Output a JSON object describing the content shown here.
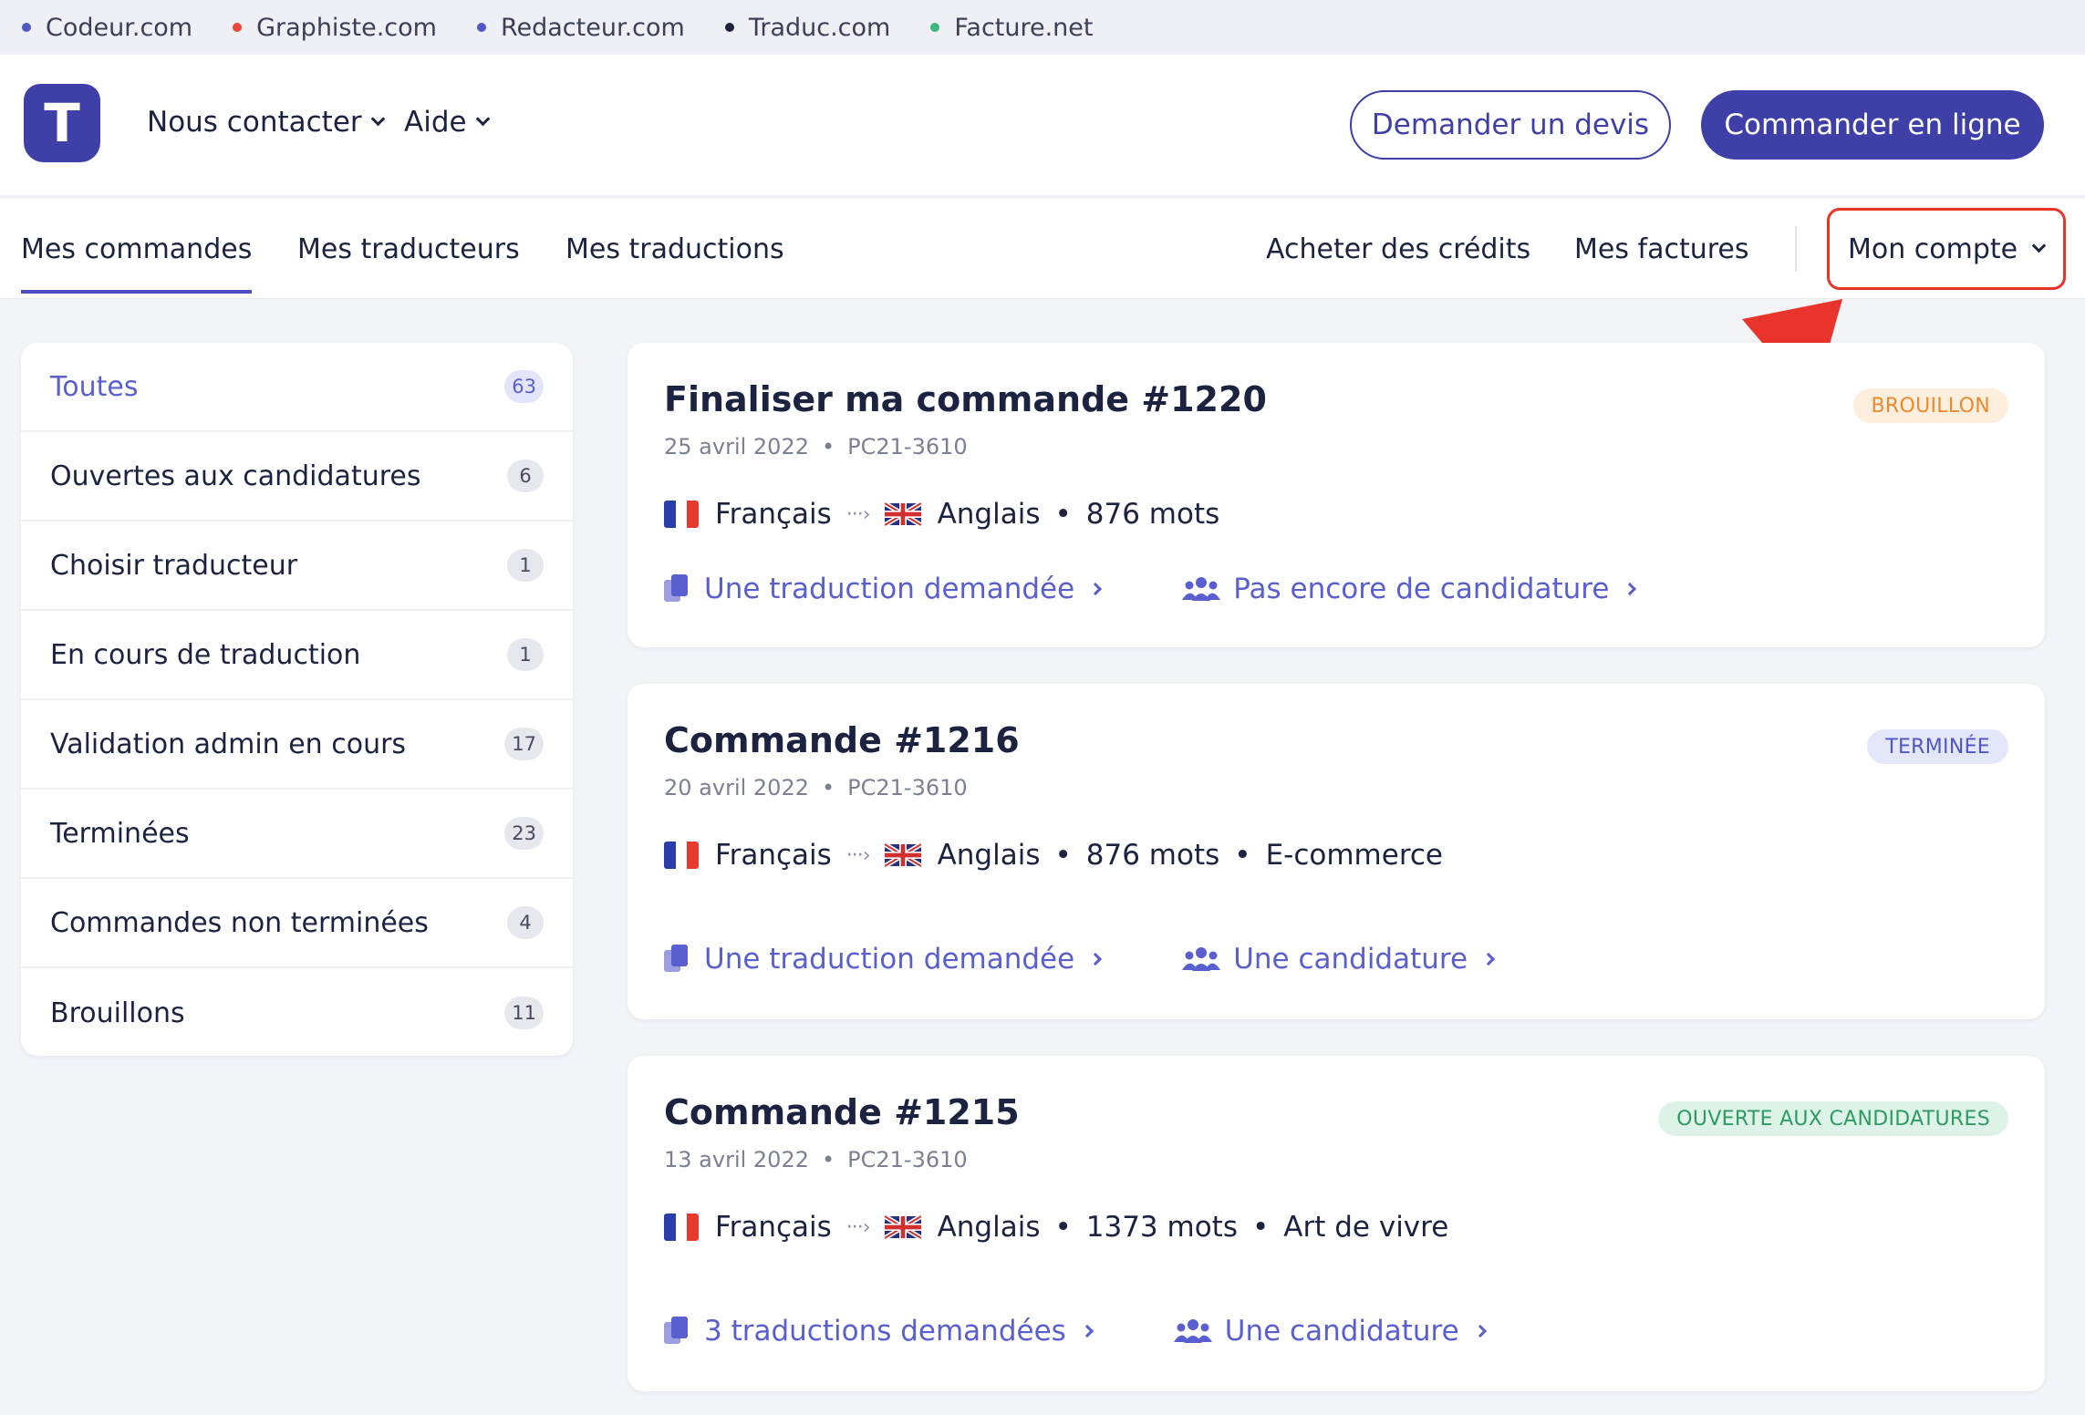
{
  "network": [
    {
      "label": "Codeur.com",
      "color": "#4f57c6"
    },
    {
      "label": "Graphiste.com",
      "color": "#e8453c"
    },
    {
      "label": "Redacteur.com",
      "color": "#4f57c6"
    },
    {
      "label": "Traduc.com",
      "color": "#1c2340"
    },
    {
      "label": "Facture.net",
      "color": "#3fb77c"
    }
  ],
  "header": {
    "logo_letter": "T",
    "contact_label": "Nous contacter",
    "help_label": "Aide",
    "quote_button": "Demander un devis",
    "order_button": "Commander en ligne"
  },
  "subnav": {
    "tabs": [
      "Mes commandes",
      "Mes traducteurs",
      "Mes traductions"
    ],
    "credits": "Acheter des crédits",
    "invoices": "Mes factures",
    "account": "Mon compte"
  },
  "sidebar": {
    "items": [
      {
        "label": "Toutes",
        "count": "63"
      },
      {
        "label": "Ouvertes aux candidatures",
        "count": "6"
      },
      {
        "label": "Choisir traducteur",
        "count": "1"
      },
      {
        "label": "En cours de traduction",
        "count": "1"
      },
      {
        "label": "Validation admin en cours",
        "count": "17"
      },
      {
        "label": "Terminées",
        "count": "23"
      },
      {
        "label": "Commandes non terminées",
        "count": "4"
      },
      {
        "label": "Brouillons",
        "count": "11"
      }
    ]
  },
  "orders": [
    {
      "title": "Finaliser ma commande #1220",
      "date": "25 avril 2022",
      "ref": "PC21-3610",
      "status": "BROUILLON",
      "status_color": "#ee8a2e",
      "status_bg": "#fdeede",
      "source_lang": "Français",
      "target_lang": "Anglais",
      "words": "876 mots",
      "category": "",
      "translations": "Une traduction demandée",
      "applications": "Pas encore de candidature"
    },
    {
      "title": "Commande #1216",
      "date": "20 avril 2022",
      "ref": "PC21-3610",
      "status": "TERMINÉE",
      "status_color": "#4f57c6",
      "status_bg": "#e4e6fa",
      "source_lang": "Français",
      "target_lang": "Anglais",
      "words": "876 mots",
      "category": "E-commerce",
      "translations": "Une traduction demandée",
      "applications": "Une candidature"
    },
    {
      "title": "Commande #1215",
      "date": "13 avril 2022",
      "ref": "PC21-3610",
      "status": "OUVERTE AUX CANDIDATURES",
      "status_color": "#2f9a63",
      "status_bg": "#def3e7",
      "source_lang": "Français",
      "target_lang": "Anglais",
      "words": "1373 mots",
      "category": "Art de vivre",
      "translations": "3 traductions demandées",
      "applications": "Une candidature"
    }
  ],
  "colors": {
    "brand": "#3f3fa8",
    "accent": "#5a5fd0",
    "highlight": "#e8342a"
  }
}
